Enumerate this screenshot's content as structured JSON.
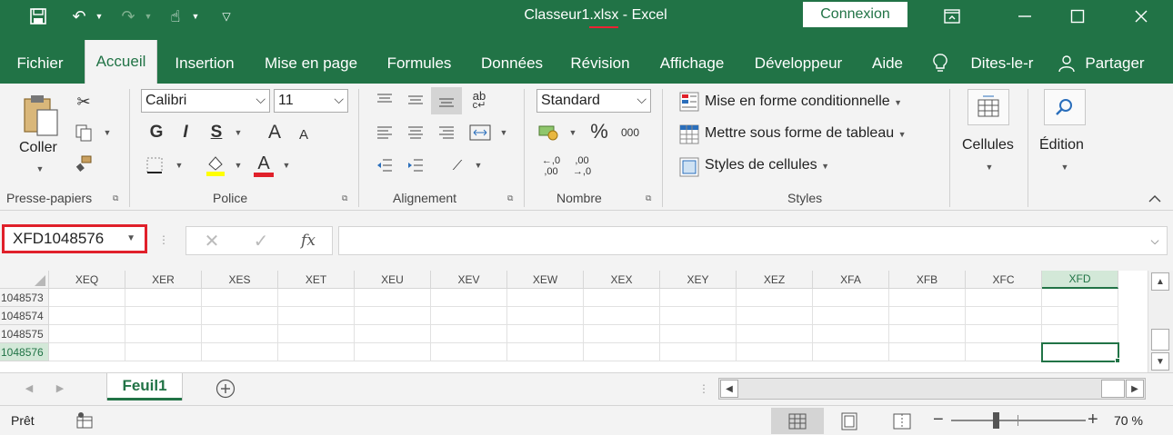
{
  "titlebar": {
    "filename": "Classeur1",
    "extension": ".xlsx",
    "separator": " - ",
    "app": "Excel",
    "connexion_label": "Connexion",
    "icons": {
      "save": "save-icon",
      "undo": "undo-icon",
      "redo": "redo-icon",
      "touch": "touch-mode-icon",
      "customize": "customize-qat-icon",
      "ribbon_display": "ribbon-display-icon",
      "minimize": "minimize-icon",
      "maximize": "maximize-icon",
      "close": "close-icon"
    }
  },
  "tabs": [
    {
      "label": "Fichier"
    },
    {
      "label": "Accueil",
      "active": true
    },
    {
      "label": "Insertion"
    },
    {
      "label": "Mise en page"
    },
    {
      "label": "Formules"
    },
    {
      "label": "Données"
    },
    {
      "label": "Révision"
    },
    {
      "label": "Affichage"
    },
    {
      "label": "Développeur"
    },
    {
      "label": "Aide"
    },
    {
      "label": "Dites-le-r"
    },
    {
      "label": "Partager"
    }
  ],
  "ribbon": {
    "clipboard": {
      "label": "Presse-papiers",
      "paste_label": "Coller"
    },
    "font": {
      "label": "Police",
      "font_name": "Calibri",
      "font_size": "11",
      "bold": "G",
      "italic": "I",
      "underline": "S",
      "grow": "A",
      "shrink": "A",
      "font_color_letter": "A"
    },
    "alignment": {
      "label": "Alignement"
    },
    "number": {
      "label": "Nombre",
      "format": "Standard",
      "percent": "%",
      "thousands": "000",
      "inc_decimal_top": "←,0",
      "inc_decimal_bottom": ",00",
      "dec_decimal_top": ",00",
      "dec_decimal_bottom": "→,0"
    },
    "styles": {
      "label": "Styles",
      "conditional": "Mise en forme conditionnelle",
      "table": "Mettre sous forme de tableau",
      "cell_styles": "Styles de cellules"
    },
    "cells": {
      "label": "Cellules"
    },
    "editing": {
      "label": "Édition"
    }
  },
  "formula_bar": {
    "name_box": "XFD1048576",
    "fx": "fx",
    "value": ""
  },
  "grid": {
    "columns": [
      "XEQ",
      "XER",
      "XES",
      "XET",
      "XEU",
      "XEV",
      "XEW",
      "XEX",
      "XEY",
      "XEZ",
      "XFA",
      "XFB",
      "XFC",
      "XFD"
    ],
    "selected_column": "XFD",
    "rows": [
      "1048573",
      "1048574",
      "1048575",
      "1048576"
    ],
    "selected_row": "1048576"
  },
  "sheets": {
    "active": "Feuil1",
    "add_icon": "add-sheet-icon"
  },
  "status": {
    "ready": "Prêt",
    "zoom_minus": "−",
    "zoom_plus": "+",
    "zoom": "70 %",
    "zoom_level": 0.7
  },
  "colors": {
    "brand": "#217346",
    "highlight_red": "#e0202a",
    "ribbon_bg": "#f3f3f3"
  }
}
